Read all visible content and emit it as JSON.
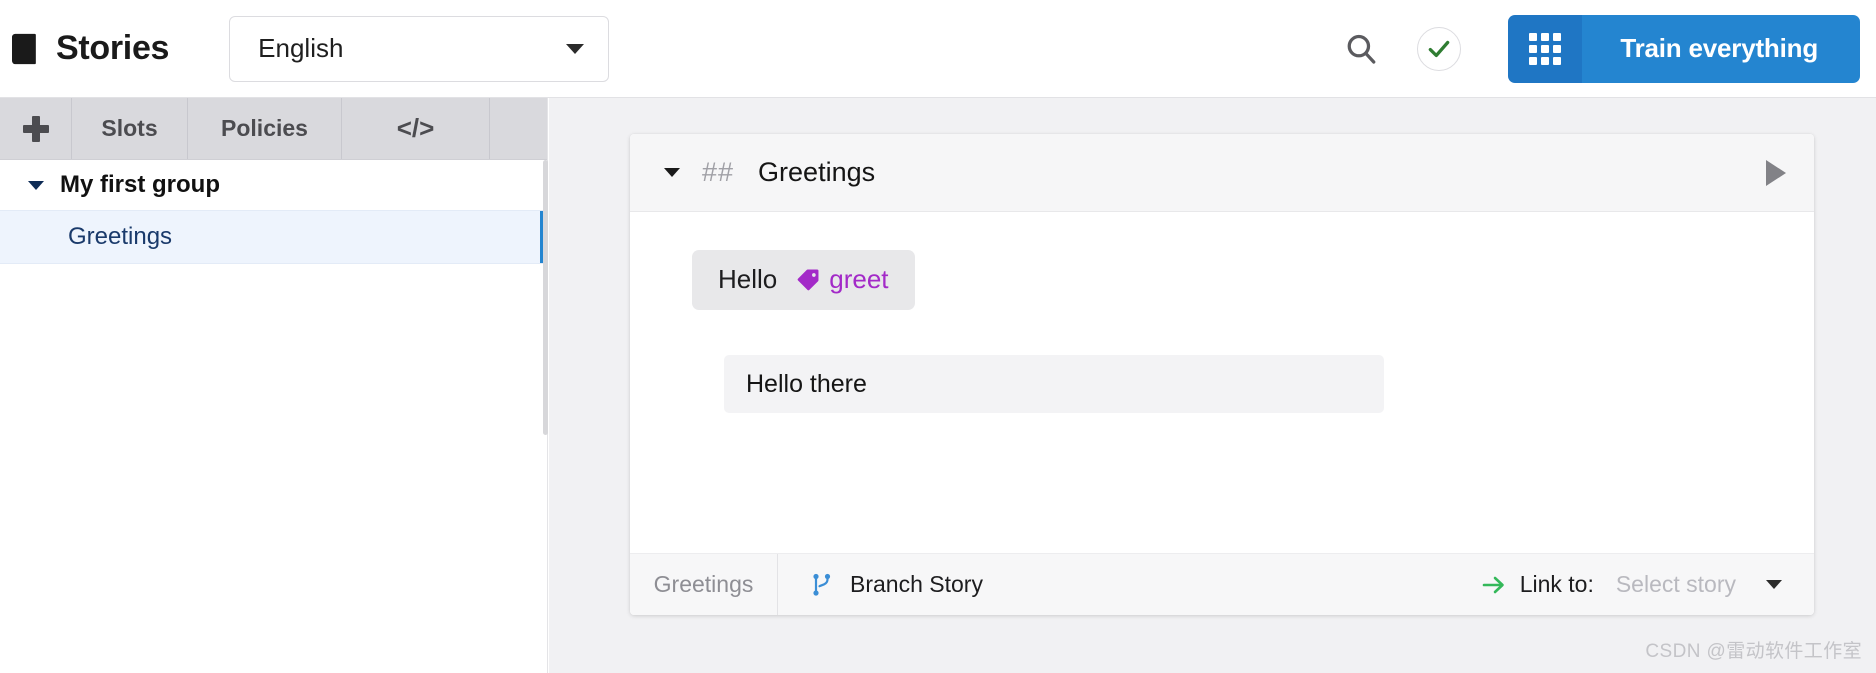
{
  "header": {
    "icon": "book-icon",
    "title": "Stories",
    "language": {
      "value": "English",
      "icon": "chevron-down-icon"
    },
    "search_icon": "search-icon",
    "status_icon": "check-circle-icon",
    "train_button": {
      "grid_icon": "grid-icon",
      "label": "Train everything"
    }
  },
  "sidebar": {
    "tabs": [
      {
        "name": "add",
        "label": "+",
        "icon": "plus-icon"
      },
      {
        "name": "slots",
        "label": "Slots"
      },
      {
        "name": "policies",
        "label": "Policies"
      },
      {
        "name": "code",
        "label": "</>",
        "icon": "code-icon"
      }
    ],
    "tree": {
      "group": {
        "label": "My first group",
        "icon": "triangle-down-icon",
        "expanded": true
      },
      "items": [
        {
          "label": "Greetings",
          "selected": true
        }
      ]
    }
  },
  "main": {
    "card": {
      "collapse_icon": "triangle-down-icon",
      "hash_prefix": "##",
      "title": "Greetings",
      "run_icon": "play-icon",
      "steps": [
        {
          "type": "user",
          "text": "Hello",
          "intent": "greet",
          "intent_icon": "tag-icon",
          "intent_color": "#a32ac8"
        },
        {
          "type": "bot",
          "text": "Hello there"
        }
      ],
      "footer": {
        "story_name": "Greetings",
        "branch_icon": "git-branch-icon",
        "branch_label": "Branch Story",
        "link_icon": "arrow-right-icon",
        "link_label": "Link to:",
        "link_placeholder": "Select story",
        "link_caret": "chevron-down-icon"
      }
    }
  },
  "watermark": "CSDN @雷动软件工作室",
  "colors": {
    "accent_blue": "#2485d0",
    "accent_blue_dark": "#1f76c4",
    "intent_purple": "#a32ac8",
    "success_green": "#2f7d32",
    "link_green": "#34b85a",
    "selected_row": "#eef4fd",
    "main_bg": "#f1f1f3",
    "tabbar_bg": "#d9d9dd"
  }
}
